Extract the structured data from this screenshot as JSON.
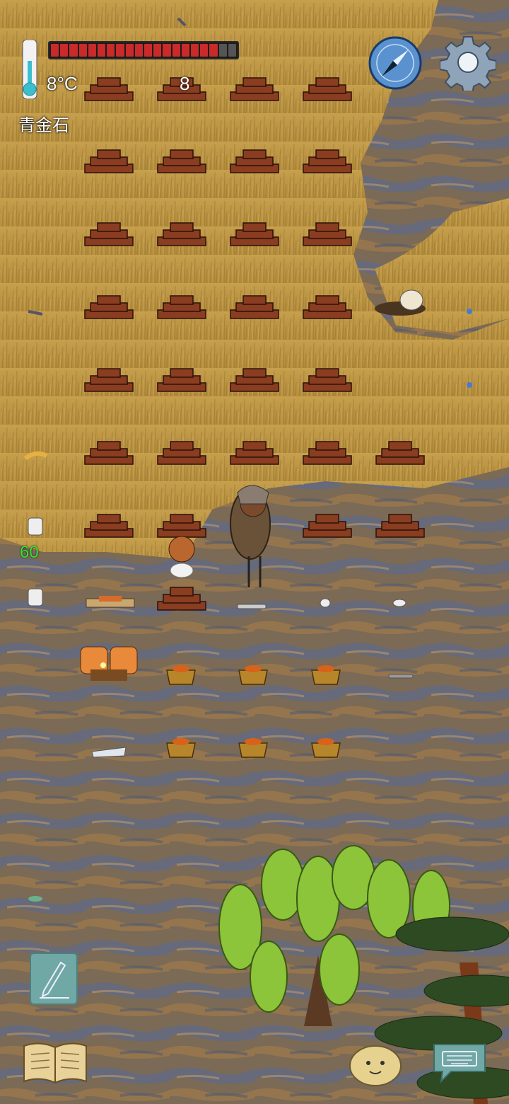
{
  "hud": {
    "temperature": "8°C",
    "item_count": "8",
    "biome_label": "青金石",
    "stat_number": "60",
    "health_fraction": 0.9
  },
  "colors": {
    "grass": "#b8913c",
    "swamp": "#7a6a5a",
    "brick": "#8a3d20",
    "health": "#c92a2a"
  },
  "icons": {
    "thermometer": "thermometer-icon",
    "compass": "compass-icon",
    "settings": "gear-icon",
    "pencil": "pencil-icon",
    "journal": "open-book-icon",
    "emote": "potato-face-icon",
    "keyboard": "keyboard-icon"
  }
}
